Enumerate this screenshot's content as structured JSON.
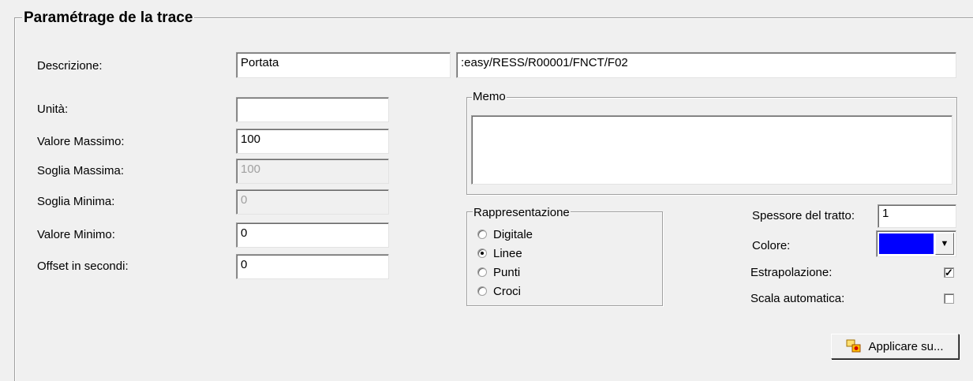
{
  "panel": {
    "title": "Paramétrage de la trace"
  },
  "labels": {
    "descrizione": "Descrizione:",
    "unita": "Unità:",
    "valore_massimo": "Valore Massimo:",
    "soglia_massima": "Soglia Massima:",
    "soglia_minima": "Soglia Minima:",
    "valore_minimo": "Valore Minimo:",
    "offset": "Offset in secondi:"
  },
  "fields": {
    "descrizione": "Portata",
    "path": ":easy/RESS/R00001/FNCT/F02",
    "unita": "",
    "valore_massimo": "100",
    "soglia_massima": "100",
    "soglia_minima": "0",
    "valore_minimo": "0",
    "offset": "0"
  },
  "memo": {
    "legend": "Memo",
    "value": ""
  },
  "rappresentazione": {
    "legend": "Rappresentazione",
    "options": [
      "Digitale",
      "Linee",
      "Punti",
      "Croci"
    ],
    "selected": "Linee"
  },
  "style": {
    "spessore_label": "Spessore del tratto:",
    "spessore_value": "1",
    "colore_label": "Colore:",
    "colore_value": "#0000ff",
    "estrapolazione_label": "Estrapolazione:",
    "estrapolazione_checked": true,
    "scala_label": "Scala automatica:",
    "scala_checked": false
  },
  "buttons": {
    "applicare": "Applicare su..."
  },
  "icons": {
    "applicare": "apply-objects-icon",
    "dropdown": "chevron-down-icon"
  }
}
